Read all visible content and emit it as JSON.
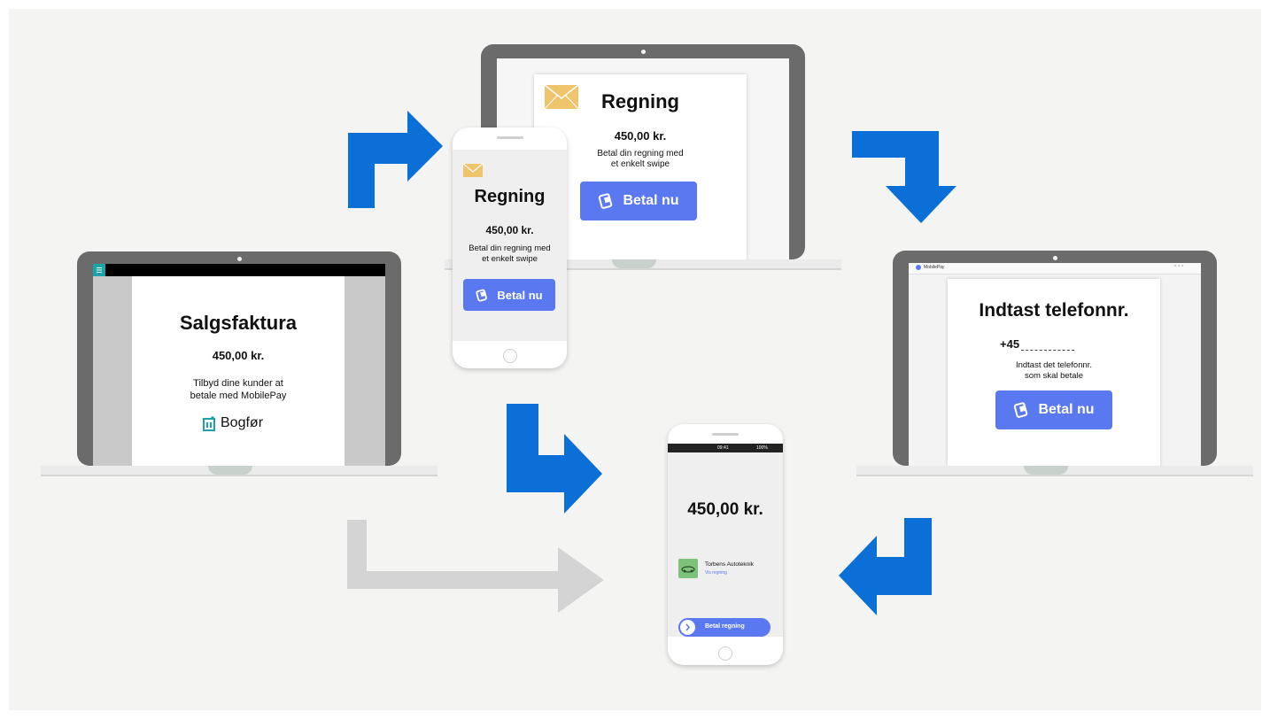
{
  "colors": {
    "arrow_blue": "#0a6fd6",
    "arrow_grey": "#d4d4d4",
    "pay_button": "#5a78f0",
    "device_frame": "#6b6b6b",
    "envelope": "#f0c46c"
  },
  "left_laptop": {
    "title": "Salgsfaktura",
    "amount": "450,00 kr.",
    "desc_line1": "Tilbyd dine kunder at",
    "desc_line2": "betale med MobilePay",
    "brand": "Bogfør",
    "brand_icon": "bogfor-logo-icon",
    "menu_icon": "hamburger-menu-icon"
  },
  "top_laptop": {
    "title": "Regning",
    "amount": "450,00 kr.",
    "desc_line1": "Betal din regning med",
    "desc_line2": "et enkelt swipe",
    "button_label": "Betal nu",
    "envelope_icon": "envelope-icon"
  },
  "small_phone": {
    "title": "Regning",
    "amount": "450,00 kr.",
    "desc_line1": "Betal din regning med",
    "desc_line2": "et enkelt swipe",
    "button_label": "Betal nu"
  },
  "right_laptop": {
    "browser_tab": "MobilePay",
    "title": "Indtast telefonnr.",
    "phone_prefix": "+45",
    "desc_line1": "Indtast det telefonnr.",
    "desc_line2": "som skal betale",
    "button_label": "Betal nu"
  },
  "center_phone": {
    "status_time": "09:41",
    "status_battery": "100%",
    "amount": "450,00 kr.",
    "merchant_name": "Torbens Autoteknik",
    "merchant_link": "Vis regning",
    "swipe_label": "Betal regning"
  }
}
